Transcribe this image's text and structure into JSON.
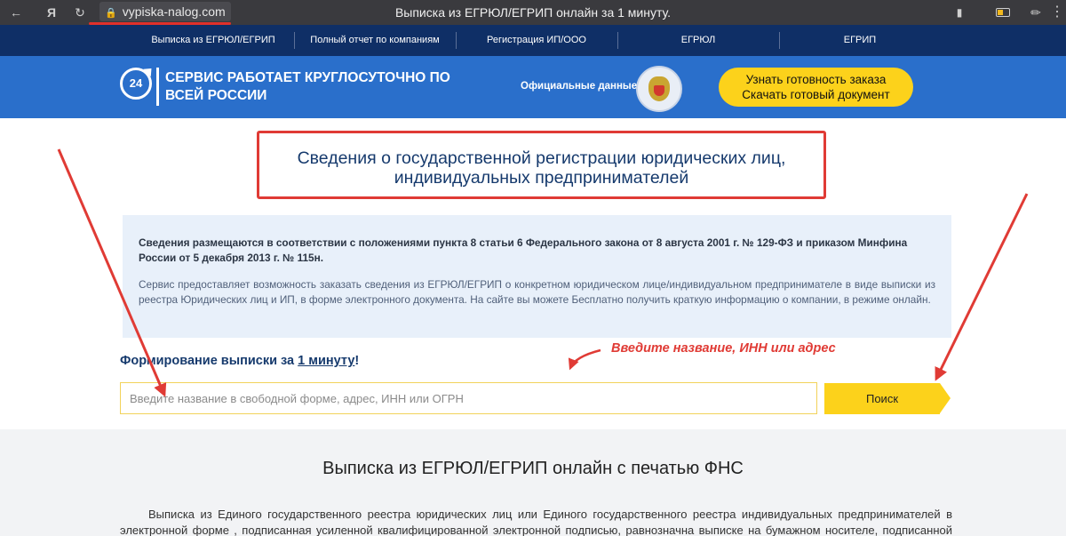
{
  "browser": {
    "yandex_icon": "Я",
    "url": "vypiska-nalog.com",
    "tab_title": "Выписка из ЕГРЮЛ/ЕГРИП онлайн за 1 минуту."
  },
  "nav": {
    "items": [
      "Выписка из ЕГРЮЛ/ЕГРИП",
      "Полный отчет по компаниям",
      "Регистрация ИП/ООО",
      "ЕГРЮЛ",
      "ЕГРИП"
    ]
  },
  "banner": {
    "badge": "24",
    "slogan": "СЕРВИС РАБОТАЕТ КРУГЛОСУТОЧНО ПО ВСЕЙ РОССИИ",
    "official": "Официальные данные",
    "cta_line1": "Узнать готовность заказа",
    "cta_line2": "Скачать готовый документ"
  },
  "headline": "Сведения о государственной регистрации юридических лиц, индивидуальных предпринимателей",
  "info": {
    "p1": "Сведения размещаются в соответствии с положениями пункта 8 статьи 6 Федерального закона от 8 августа 2001 г. № 129-ФЗ и приказом Минфина России от 5 декабря 2013 г. № 115н.",
    "p2": "Сервис предоставляет возможность заказать сведения из ЕГРЮЛ/ЕГРИП о конкретном юридическом лице/индивидуальном предпринимателе в виде выписки из реестра Юридических лиц и ИП, в форме электронного документа. На сайте вы можете Бесплатно получить краткую информацию о компании, в режиме онлайн."
  },
  "form": {
    "title_prefix": "Формирование выписки за ",
    "title_link": "1 минуту",
    "title_suffix": "!",
    "hint": "Введите название, ИНН или адрес",
    "placeholder": "Введите название в свободной форме, адрес, ИНН или ОГРН",
    "button": "Поиск"
  },
  "bottom": {
    "title": "Выписка из ЕГРЮЛ/ЕГРИП онлайн с печатью ФНС",
    "text": "Выписка из Единого государственного реестра юридических лиц или Единого государственного реестра индивидуальных предпринимателей в электронной форме , подписанная усиленной квалифицированной электронной подписью, равнозначна выписке на бумажном носителе, подписанной собственноручной"
  },
  "colors": {
    "nav_bg": "#0f2f66",
    "banner_bg": "#2a6fcb",
    "accent_yellow": "#fcd21b",
    "annotation_red": "#e03b35",
    "heading_blue": "#163a6d"
  }
}
